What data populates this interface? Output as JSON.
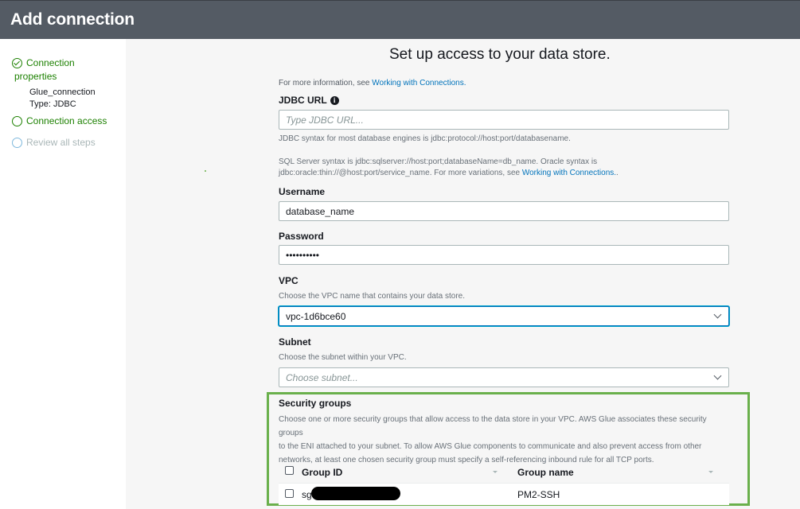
{
  "header": {
    "title": "Add connection"
  },
  "sidebar": {
    "steps": [
      {
        "label": "Connection",
        "label2": "properties",
        "status": "complete"
      },
      {
        "label": "Connection access",
        "status": "current"
      },
      {
        "label": "Review all steps",
        "status": "disabled"
      }
    ],
    "summary": {
      "name": "Glue_connection",
      "type": "Type: JDBC"
    }
  },
  "main": {
    "title": "Set up access to your data store.",
    "more_info_prefix": "For more information, see ",
    "more_info_link": "Working with Connections.",
    "jdbc": {
      "label": "JDBC URL",
      "placeholder": "Type JDBC URL...",
      "value": "",
      "hint1": "JDBC syntax for most database engines is jdbc:protocol://host:port/databasename.",
      "hint2": "SQL Server syntax is jdbc:sqlserver://host:port;databaseName=db_name. Oracle syntax is",
      "hint3_prefix": "jdbc:oracle:thin://@host:port/service_name. For more variations, see ",
      "hint3_link": "Working with Connections.",
      "hint3_suffix": "."
    },
    "username": {
      "label": "Username",
      "value": "database_name"
    },
    "password": {
      "label": "Password",
      "value": "••••••••••"
    },
    "vpc": {
      "label": "VPC",
      "description": "Choose the VPC name that contains your data store.",
      "value": "vpc-1d6bce60"
    },
    "subnet": {
      "label": "Subnet",
      "description": "Choose the subnet within your VPC.",
      "placeholder": "Choose subnet..."
    },
    "security_groups": {
      "label": "Security groups",
      "description_lines": [
        "Choose one or more security groups that allow access to the data store in your VPC. AWS Glue associates these security groups",
        "to the ENI attached to your subnet. To allow AWS Glue components to communicate and also prevent access from other",
        "networks, at least one chosen security group must specify a self-referencing inbound rule for all TCP ports."
      ],
      "columns": [
        "Group ID",
        "Group name"
      ],
      "rows": [
        {
          "group_id": "sg",
          "group_name": "PM2-SSH"
        }
      ]
    }
  },
  "colors": {
    "header_bg": "#545b64",
    "success": "#1d8102",
    "link": "#0073bb",
    "highlight_border": "#6ab04c"
  }
}
